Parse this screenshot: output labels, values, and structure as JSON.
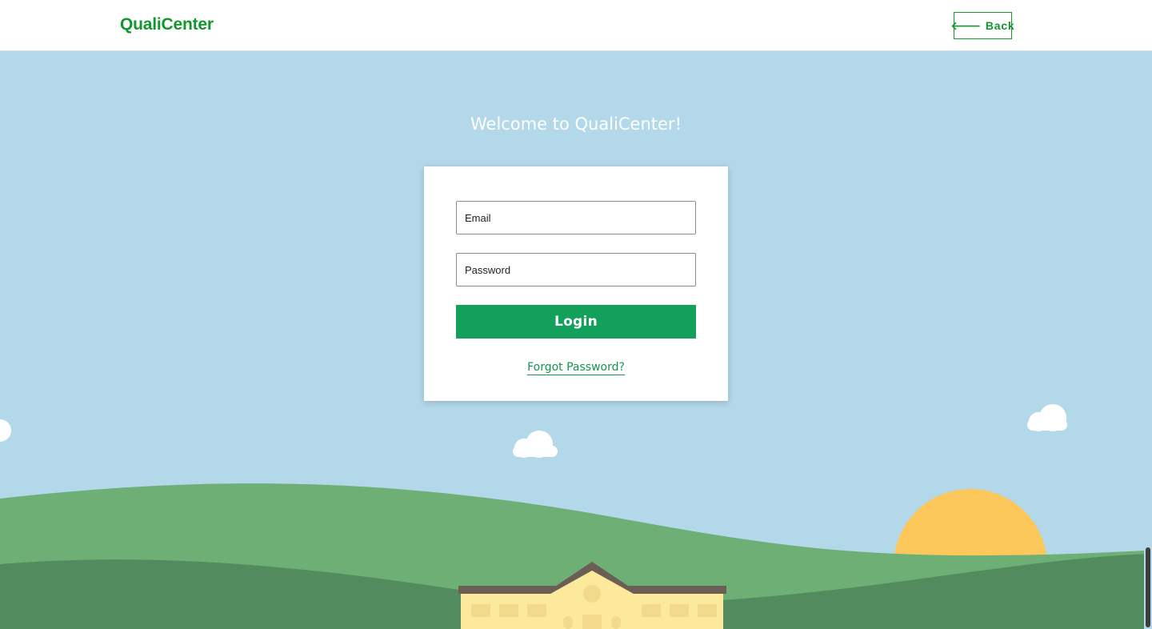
{
  "header": {
    "brand": "QualiCenter",
    "back_label": "Back"
  },
  "main": {
    "welcome": "Welcome to QualiCenter!"
  },
  "login_form": {
    "email_placeholder": "Email",
    "password_placeholder": "Password",
    "login_label": "Login",
    "forgot_label": "Forgot Password?"
  },
  "colors": {
    "brand_green": "#12962e",
    "button_green": "#12a05a",
    "sky": "#b3d8ea",
    "hill_light": "#6daf74",
    "hill_dark": "#528c5e",
    "sun": "#fcc85c",
    "building": "#fde99c",
    "roof": "#6b5f55"
  },
  "icons": {
    "back": "arrow-left-icon"
  }
}
